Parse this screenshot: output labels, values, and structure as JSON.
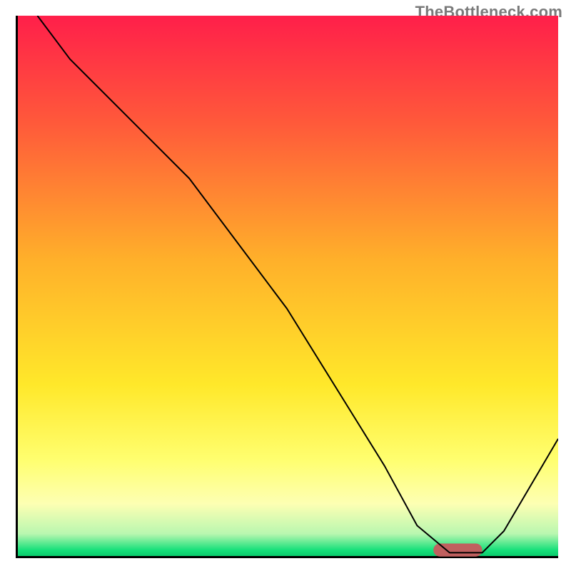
{
  "watermark": "TheBottleneck.com",
  "chart_data": {
    "type": "line",
    "title": "",
    "xlabel": "",
    "ylabel": "",
    "xlim": [
      0,
      100
    ],
    "ylim": [
      0,
      100
    ],
    "grid": false,
    "legend": false,
    "background_gradient": {
      "stops": [
        {
          "offset": 0.0,
          "color": "#ff1f4a"
        },
        {
          "offset": 0.2,
          "color": "#ff5a3a"
        },
        {
          "offset": 0.45,
          "color": "#ffb02a"
        },
        {
          "offset": 0.68,
          "color": "#ffe82a"
        },
        {
          "offset": 0.82,
          "color": "#ffff70"
        },
        {
          "offset": 0.9,
          "color": "#fdffb3"
        },
        {
          "offset": 0.955,
          "color": "#b9f7b0"
        },
        {
          "offset": 0.985,
          "color": "#17e07a"
        },
        {
          "offset": 1.0,
          "color": "#06c468"
        }
      ]
    },
    "series": [
      {
        "name": "bottleneck-curve",
        "color": "#000000",
        "width": 2,
        "x": [
          4,
          10,
          24,
          32,
          50,
          68,
          74,
          80,
          86,
          90,
          100
        ],
        "y": [
          100,
          92,
          78,
          70,
          46,
          17,
          6,
          1,
          1,
          5,
          22
        ]
      }
    ],
    "marker": {
      "name": "optimal-range-marker",
      "shape": "rounded-bar",
      "color": "#c0605f",
      "x_start": 77,
      "x_end": 86,
      "y": 1.5,
      "thickness": 2.4
    },
    "axes": {
      "color": "#000000",
      "width": 3
    }
  }
}
